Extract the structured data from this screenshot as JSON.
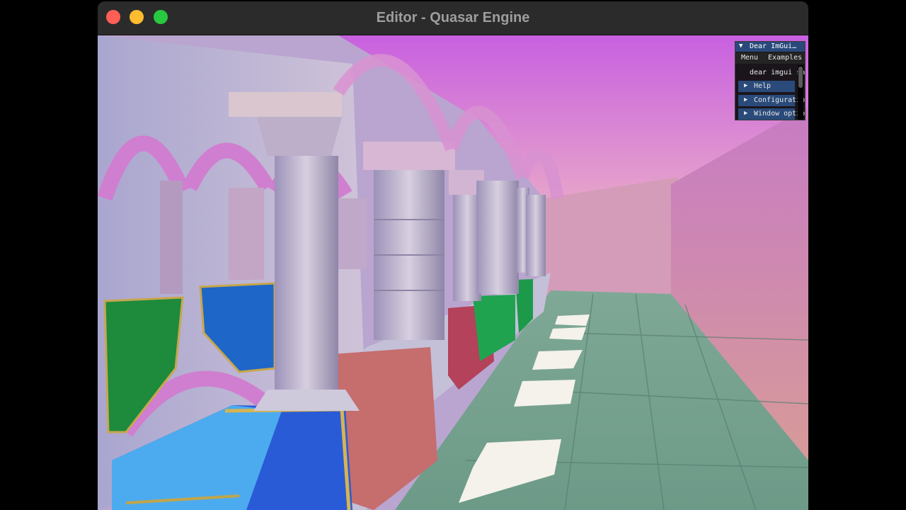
{
  "window": {
    "title": "Editor - Quasar Engine"
  },
  "viewport": {
    "scene": "sponza-atrium"
  },
  "imgui": {
    "title": "Dear ImGui…",
    "menu": [
      "Menu",
      "Examples"
    ],
    "text": "dear imgui says",
    "headers": [
      "Help",
      "Configuration",
      "Window options"
    ]
  },
  "colors": {
    "close": "#fe5f57",
    "minimize": "#febc2e",
    "maximize": "#28c840",
    "imgui_title": "#29497b",
    "imgui_header": "#294a7a"
  }
}
